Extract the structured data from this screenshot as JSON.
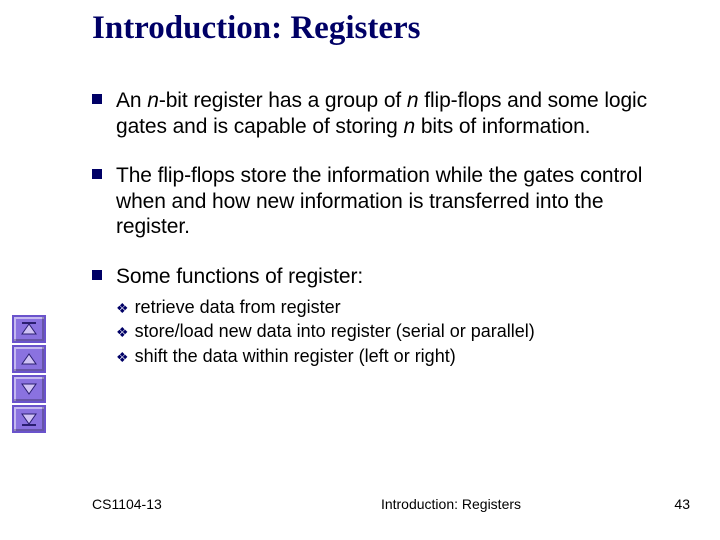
{
  "title": "Introduction: Registers",
  "bullets": {
    "b1_pre": "An ",
    "b1_ital1": "n",
    "b1_mid1": "-bit register has a group of ",
    "b1_ital2": "n",
    "b1_mid2": " flip-flops and some logic gates and is capable of storing ",
    "b1_ital3": "n",
    "b1_post": " bits of information.",
    "b2": "The flip-flops store the information while the gates control when and how new information is transferred into the register.",
    "b3": "Some functions of register:"
  },
  "subbullets": {
    "s1": "retrieve data from register",
    "s2": "store/load new data into register (serial or parallel)",
    "s3": "shift the data within register (left or right)"
  },
  "footer": {
    "left": "CS1104-13",
    "center": "Introduction: Registers",
    "right": "43"
  },
  "nav_icons": {
    "first": "nav-first",
    "prev": "nav-prev",
    "next": "nav-next",
    "last": "nav-last"
  }
}
